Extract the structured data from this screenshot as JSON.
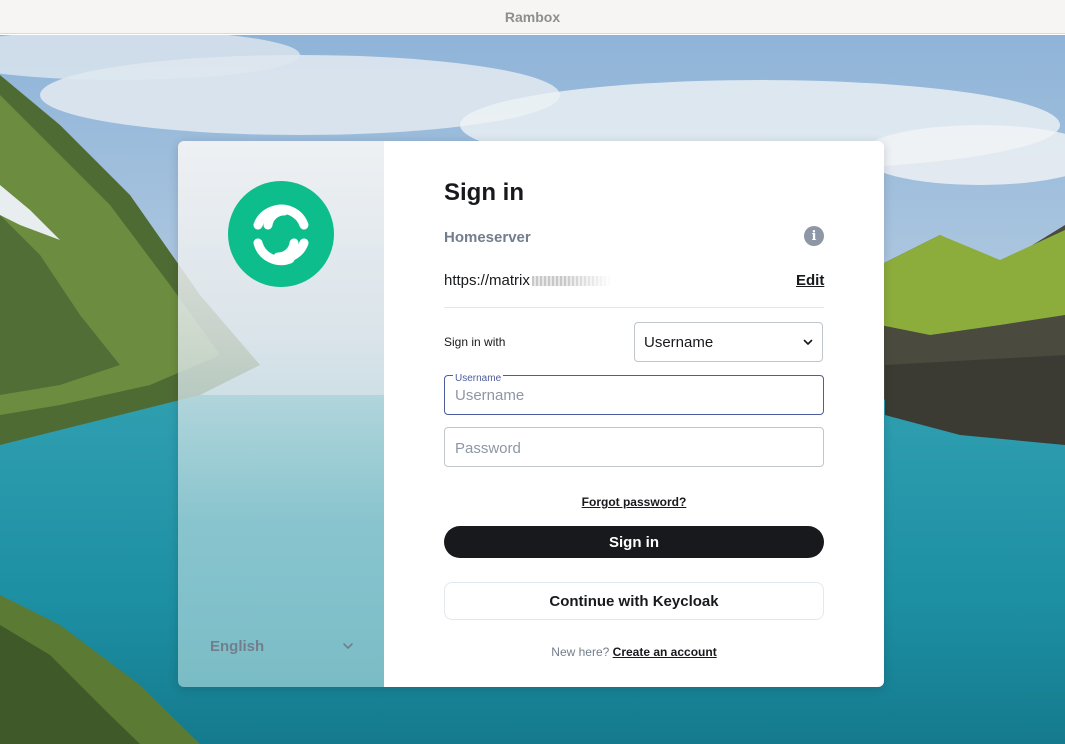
{
  "window": {
    "title": "Rambox"
  },
  "auth": {
    "language": "English",
    "heading": "Sign in",
    "homeserver": {
      "label": "Homeserver",
      "url": "https://matrix",
      "edit_label": "Edit"
    },
    "sign_in_with": {
      "label": "Sign in with",
      "selected": "Username"
    },
    "username": {
      "floating_label": "Username",
      "placeholder": "Username",
      "value": ""
    },
    "password": {
      "placeholder": "Password",
      "value": ""
    },
    "forgot_password": "Forgot password?",
    "sign_in_button": "Sign in",
    "sso_button": "Continue with Keycloak",
    "new_here": "New here?",
    "create_account": "Create an account"
  },
  "colors": {
    "brand": "#0dbd8b",
    "primary_button": "#17191c",
    "focus_border": "#4d5d9e",
    "secondary_text": "#737d8c"
  },
  "icons": [
    "element-logo-icon",
    "chevron-down-icon",
    "info-icon"
  ]
}
